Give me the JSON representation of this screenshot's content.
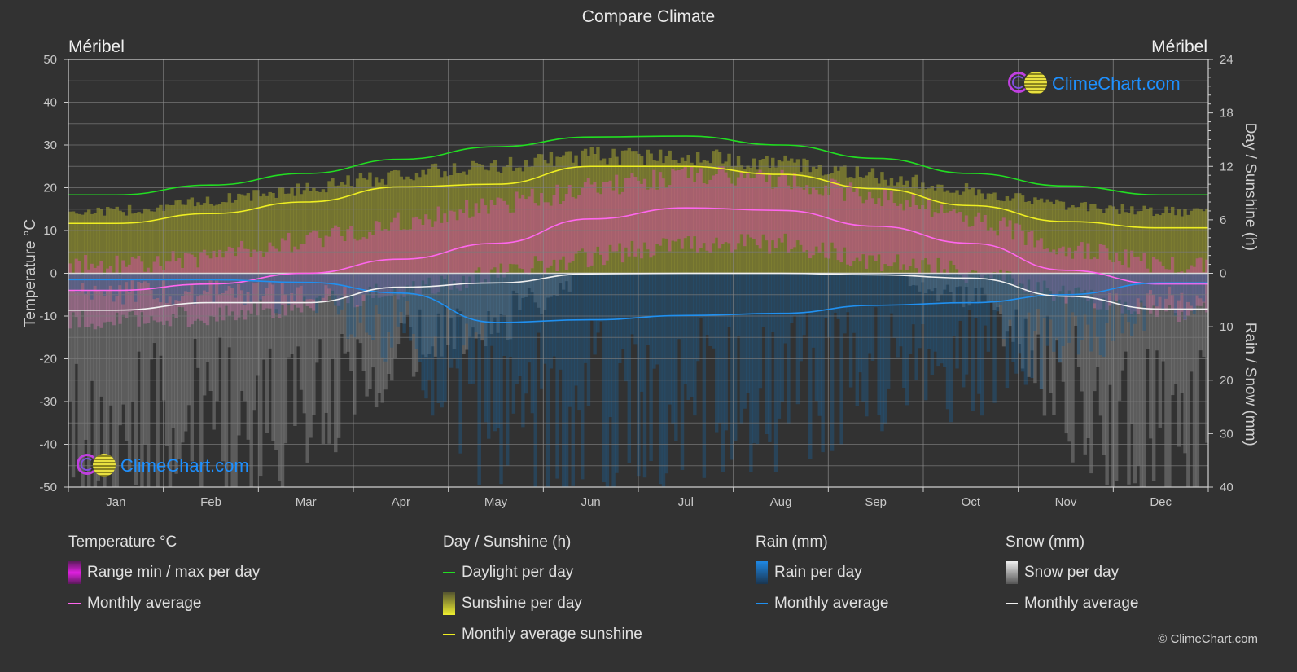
{
  "header": {
    "title": "Compare Climate",
    "location_left": "Méribel",
    "location_right": "Méribel"
  },
  "brand": {
    "name": "ClimeChart.com",
    "copyright": "© ClimeChart.com"
  },
  "chart_data": {
    "type": "line",
    "title": "Compare Climate",
    "categories": [
      "Jan",
      "Feb",
      "Mar",
      "Apr",
      "May",
      "Jun",
      "Jul",
      "Aug",
      "Sep",
      "Oct",
      "Nov",
      "Dec"
    ],
    "left_axis": {
      "label": "Temperature °C",
      "range": [
        -50,
        50
      ],
      "ticks": [
        "50",
        "40",
        "30",
        "20",
        "10",
        "0",
        "-10",
        "-20",
        "-30",
        "-40",
        "-50"
      ]
    },
    "right_axis_top": {
      "label": "Day / Sunshine (h)",
      "range": [
        0,
        24
      ],
      "ticks": [
        "24",
        "18",
        "12",
        "6",
        "0"
      ]
    },
    "right_axis_bottom": {
      "label": "Rain / Snow (mm)",
      "range": [
        0,
        40
      ],
      "ticks": [
        "0",
        "10",
        "20",
        "30",
        "40"
      ]
    },
    "grid": true,
    "series": [
      {
        "name": "Temperature monthly average",
        "axis": "temperature",
        "color": "#ff66ee",
        "values": [
          -4.0,
          -2.5,
          0.0,
          3.3,
          7.0,
          12.7,
          15.3,
          14.7,
          11.0,
          7.0,
          0.7,
          -2.5
        ]
      },
      {
        "name": "Daylight per day",
        "axis": "hours",
        "color": "#22dd22",
        "values": [
          8.8,
          9.9,
          11.2,
          12.8,
          14.2,
          15.3,
          15.4,
          14.4,
          12.9,
          11.2,
          9.8,
          8.8
        ]
      },
      {
        "name": "Monthly average sunshine",
        "axis": "hours",
        "color": "#eeee22",
        "values": [
          5.6,
          6.7,
          8.0,
          9.7,
          10.0,
          12.0,
          12.0,
          11.1,
          9.5,
          7.6,
          5.8,
          5.1
        ]
      },
      {
        "name": "Rain monthly average",
        "axis": "precip",
        "color": "#2090f0",
        "values": [
          1.2,
          1.2,
          1.7,
          3.7,
          9.2,
          8.7,
          7.9,
          7.5,
          6.0,
          5.5,
          4.0,
          1.8
        ]
      },
      {
        "name": "Snow monthly average",
        "axis": "precip",
        "color": "#f0f0f0",
        "values": [
          6.9,
          5.5,
          5.5,
          2.6,
          1.8,
          0.1,
          0.0,
          0.0,
          0.3,
          0.9,
          4.3,
          6.7
        ]
      }
    ],
    "ranges": {
      "temp_max_daily_approx": [
        2,
        4,
        8,
        12,
        16,
        20,
        23,
        22,
        18,
        13,
        6,
        2
      ],
      "temp_min_daily_approx": [
        -11,
        -10,
        -7,
        -4,
        0,
        4,
        7,
        7,
        3,
        0,
        -5,
        -9
      ],
      "sunshine_band_top_hours": [
        7.5,
        8.8,
        10.3,
        12.0,
        13.0,
        14.3,
        14.3,
        13.4,
        11.8,
        10.0,
        8.2,
        7.5
      ]
    },
    "legend": [
      {
        "group": "Temperature °C",
        "items": [
          {
            "label": "Range min / max per day",
            "type": "bar",
            "color": "#e020e0"
          },
          {
            "label": "Monthly average",
            "type": "line",
            "color": "#ff66ee"
          }
        ]
      },
      {
        "group": "Day / Sunshine (h)",
        "items": [
          {
            "label": "Daylight per day",
            "type": "line",
            "color": "#22dd22"
          },
          {
            "label": "Sunshine per day",
            "type": "bar",
            "color": "#eeee30"
          },
          {
            "label": "Monthly average sunshine",
            "type": "line",
            "color": "#eeee22"
          }
        ]
      },
      {
        "group": "Rain (mm)",
        "items": [
          {
            "label": "Rain per day",
            "type": "bar",
            "color": "#1e88e5"
          },
          {
            "label": "Monthly average",
            "type": "line",
            "color": "#2090f0"
          }
        ]
      },
      {
        "group": "Snow (mm)",
        "items": [
          {
            "label": "Snow per day",
            "type": "bar",
            "color": "#e8e8e8"
          },
          {
            "label": "Monthly average",
            "type": "line",
            "color": "#f0f0f0"
          }
        ]
      }
    ],
    "legend_position": "bottom"
  }
}
